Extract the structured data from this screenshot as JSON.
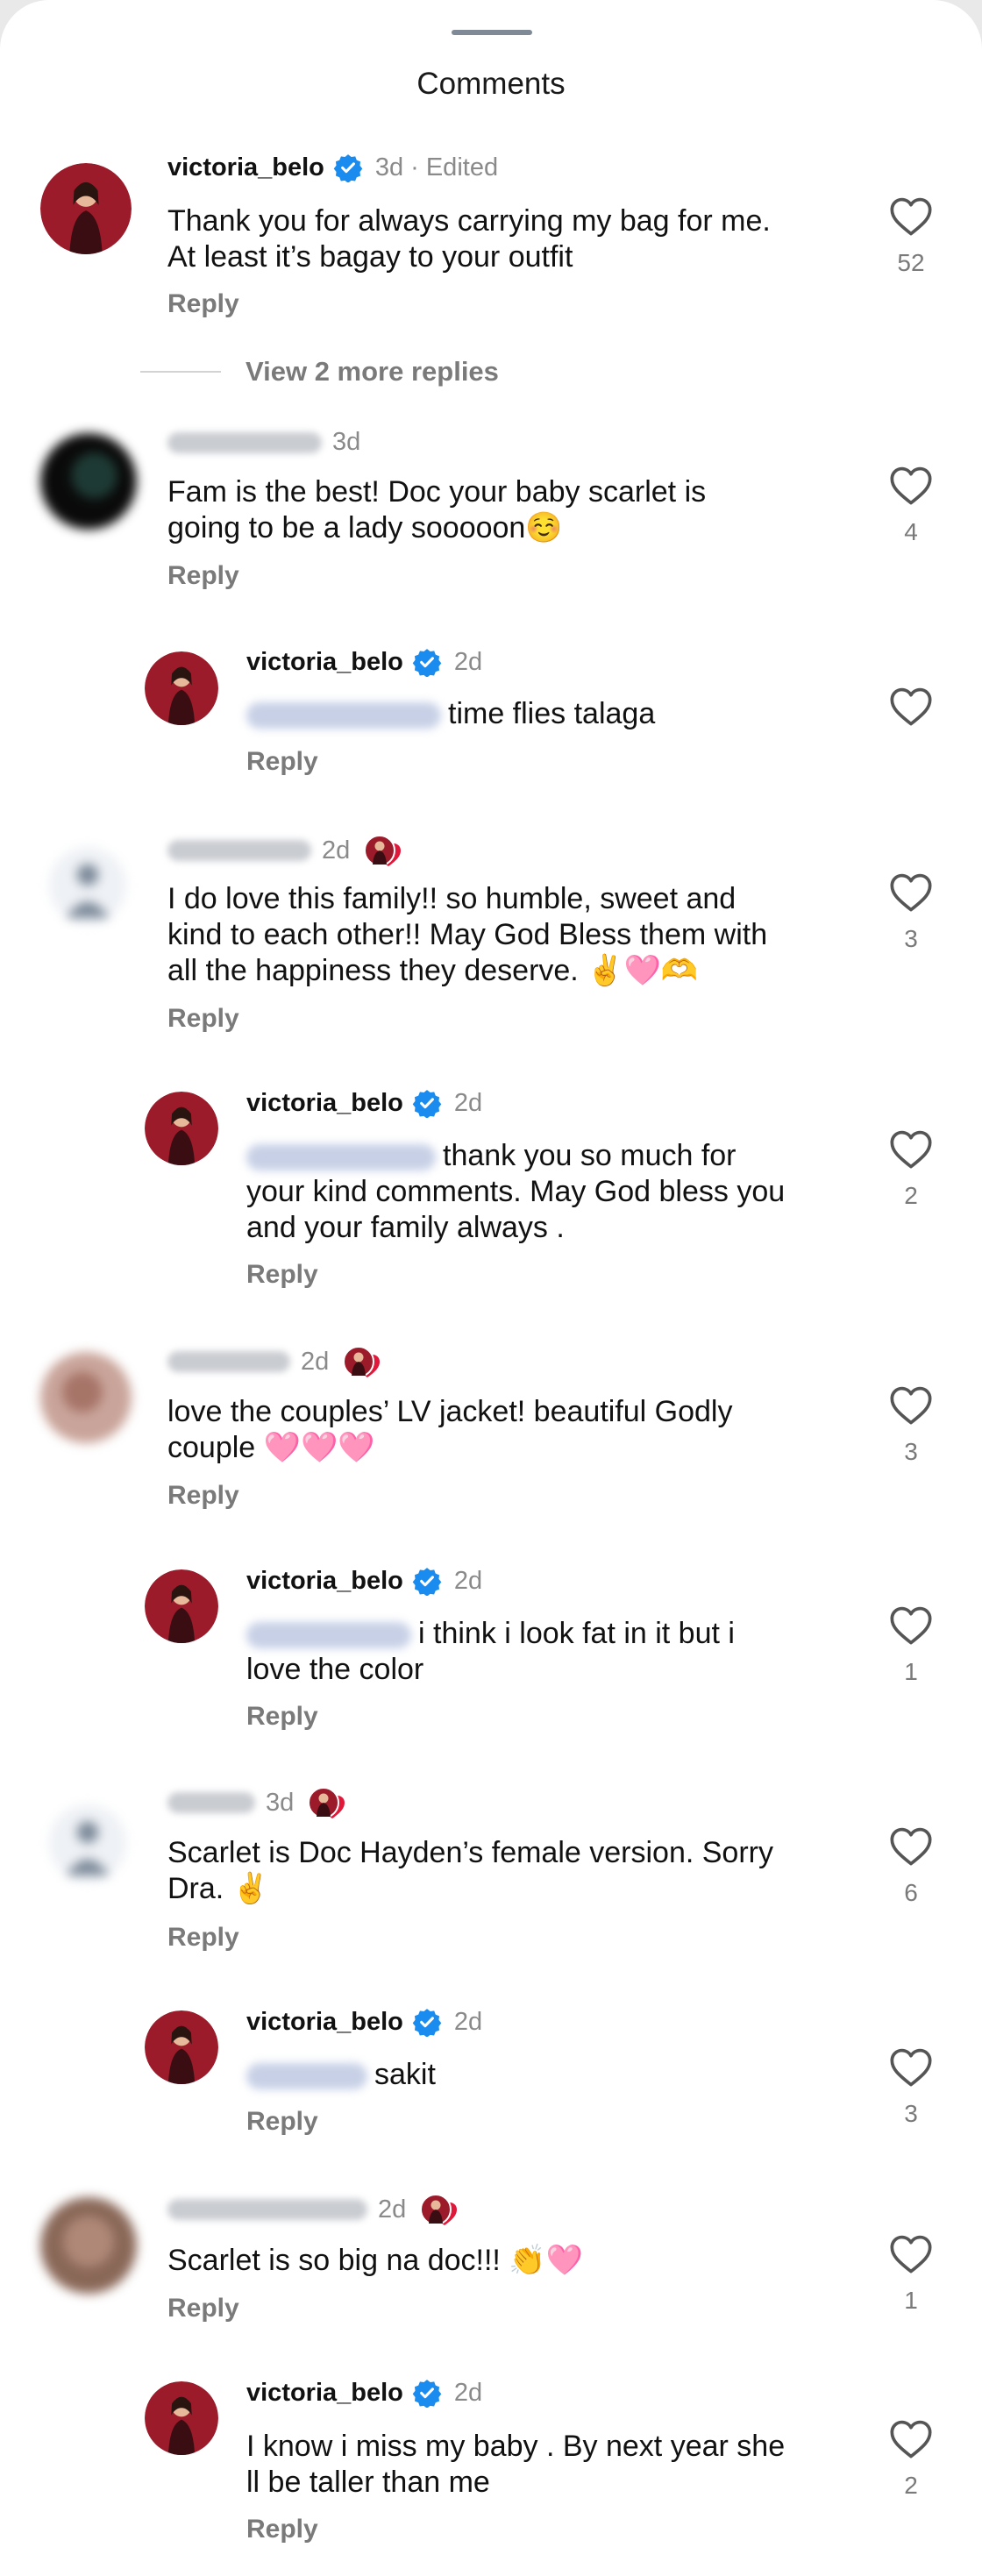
{
  "sheet": {
    "title": "Comments"
  },
  "comments": [
    {
      "username": "victoria_belo",
      "verified": true,
      "time": "3d",
      "edited": "Edited",
      "lines": [
        "Thank you for always carrying my bag for me.",
        "At least it’s bagay to your outfit"
      ],
      "reply_label": "Reply",
      "likes": "52",
      "more_replies": "View 2 more replies"
    },
    {
      "username": "",
      "time": "3d",
      "lines": [
        "Fam is the best! Doc your baby scarlet is",
        "going to be a lady sooooon☺️"
      ],
      "reply_label": "Reply",
      "likes": "4"
    },
    {
      "username": "victoria_belo",
      "verified": true,
      "time": "2d",
      "lines": [
        "time flies talaga"
      ],
      "reply_label": "Reply",
      "likes": ""
    },
    {
      "username": "",
      "time": "2d",
      "lines": [
        "I do love this family!! so humble, sweet and",
        "kind to each other!! May God Bless them with",
        "all the happiness they deserve. ✌️🩷🫶"
      ],
      "reply_label": "Reply",
      "likes": "3"
    },
    {
      "username": "victoria_belo",
      "verified": true,
      "time": "2d",
      "lines": [
        "thank you so much for",
        "your kind comments. May God bless you",
        "and your family always ."
      ],
      "reply_label": "Reply",
      "likes": "2"
    },
    {
      "username": "",
      "time": "2d",
      "lines": [
        "love the couples’ LV jacket!  beautiful Godly",
        "couple 🩷🩷🩷"
      ],
      "reply_label": "Reply",
      "likes": "3"
    },
    {
      "username": "victoria_belo",
      "verified": true,
      "time": "2d",
      "lines": [
        "i think i look fat in it but i",
        "love the color"
      ],
      "reply_label": "Reply",
      "likes": "1"
    },
    {
      "username": "",
      "time": "3d",
      "lines": [
        "Scarlet is Doc Hayden’s female version. Sorry",
        "Dra. ✌️"
      ],
      "reply_label": "Reply",
      "likes": "6"
    },
    {
      "username": "victoria_belo",
      "verified": true,
      "time": "2d",
      "lines": [
        "sakit"
      ],
      "reply_label": "Reply",
      "likes": "3"
    },
    {
      "username": "",
      "time": "2d",
      "lines": [
        "Scarlet is so big na doc!!! 👏🩷"
      ],
      "reply_label": "Reply",
      "likes": "1"
    },
    {
      "username": "victoria_belo",
      "verified": true,
      "time": "2d",
      "lines": [
        "I know i miss my baby . By next year she",
        "ll be taller than me"
      ],
      "reply_label": "Reply",
      "likes": "2"
    }
  ],
  "colors": {
    "verified_blue": "#1a8cf0",
    "brand_red": "#9c1b2a",
    "muted_text": "#7a7a7a"
  },
  "icons": [
    "heart-outline-icon",
    "verified-badge-icon",
    "profile-sticker-icon"
  ]
}
